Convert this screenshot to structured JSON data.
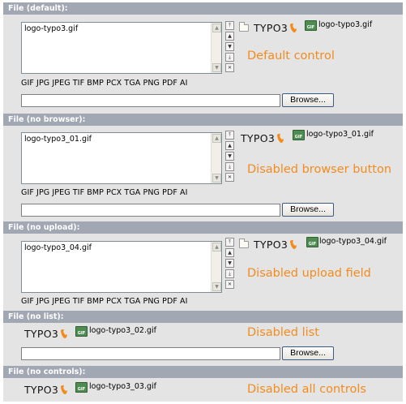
{
  "sections": [
    {
      "header": "File (default):",
      "list_item": "logo-typo3.gif",
      "logo_text": "TYPO3",
      "thumb_name": "logo-typo3.gif",
      "caption": "Default control",
      "allowed": "GIF JPG JPEG TIF BMP PCX TGA PNG PDF AI",
      "browse_label": "Browse...",
      "thumb_type": "GIF"
    },
    {
      "header": "File (no browser):",
      "list_item": "logo-typo3_01.gif",
      "logo_text": "TYPO3",
      "thumb_name": "logo-typo3_01.gif",
      "caption": "Disabled browser button",
      "allowed": "GIF JPG JPEG TIF BMP PCX TGA PNG PDF AI",
      "browse_label": "Browse...",
      "thumb_type": "GIF"
    },
    {
      "header": "File (no upload):",
      "list_item": "logo-typo3_04.gif",
      "logo_text": "TYPO3",
      "thumb_name": "logo-typo3_04.gif",
      "caption": "Disabled upload field",
      "allowed": "GIF JPG JPEG TIF BMP PCX TGA PNG PDF AI",
      "thumb_type": "GIF"
    },
    {
      "header": "File (no list):",
      "logo_text": "TYPO3",
      "thumb_name": "logo-typo3_02.gif",
      "caption": "Disabled list",
      "browse_label": "Browse...",
      "thumb_type": "GIF"
    },
    {
      "header": "File (no controls):",
      "logo_text": "TYPO3",
      "thumb_name": "logo-typo3_03.gif",
      "caption": "Disabled all controls",
      "thumb_type": "GIF"
    }
  ],
  "colors": {
    "header_bg": "#a2a7b4",
    "section_bg": "#e4e4e4",
    "caption": "#f28c1e",
    "flame": "#f28c1e"
  }
}
